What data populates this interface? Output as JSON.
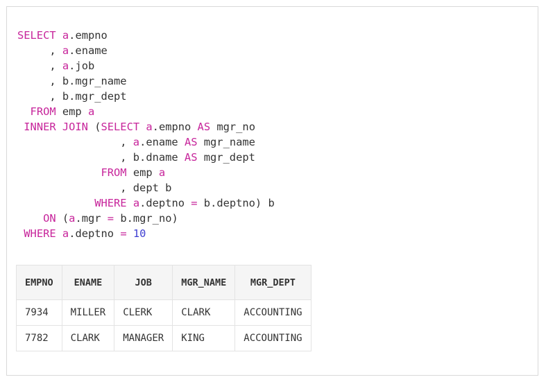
{
  "sql": {
    "lines": [
      [
        {
          "t": "SELECT",
          "c": "k"
        },
        {
          "t": " "
        },
        {
          "t": "a",
          "c": "k"
        },
        {
          "t": ".empno"
        }
      ],
      [
        {
          "t": "     , "
        },
        {
          "t": "a",
          "c": "k"
        },
        {
          "t": ".ename"
        }
      ],
      [
        {
          "t": "     , "
        },
        {
          "t": "a",
          "c": "k"
        },
        {
          "t": ".job"
        }
      ],
      [
        {
          "t": "     , b.mgr_name"
        }
      ],
      [
        {
          "t": "     , b.mgr_dept"
        }
      ],
      [
        {
          "t": "  "
        },
        {
          "t": "FROM",
          "c": "k"
        },
        {
          "t": " emp "
        },
        {
          "t": "a",
          "c": "k"
        }
      ],
      [
        {
          "t": " "
        },
        {
          "t": "INNER JOIN",
          "c": "k"
        },
        {
          "t": " ("
        },
        {
          "t": "SELECT",
          "c": "k"
        },
        {
          "t": " "
        },
        {
          "t": "a",
          "c": "k"
        },
        {
          "t": ".empno "
        },
        {
          "t": "AS",
          "c": "k"
        },
        {
          "t": " mgr_no"
        }
      ],
      [
        {
          "t": "                , "
        },
        {
          "t": "a",
          "c": "k"
        },
        {
          "t": ".ename "
        },
        {
          "t": "AS",
          "c": "k"
        },
        {
          "t": " mgr_name"
        }
      ],
      [
        {
          "t": "                , b.dname "
        },
        {
          "t": "AS",
          "c": "k"
        },
        {
          "t": " mgr_dept"
        }
      ],
      [
        {
          "t": "             "
        },
        {
          "t": "FROM",
          "c": "k"
        },
        {
          "t": " emp "
        },
        {
          "t": "a",
          "c": "k"
        }
      ],
      [
        {
          "t": "                , dept b"
        }
      ],
      [
        {
          "t": "            "
        },
        {
          "t": "WHERE",
          "c": "k"
        },
        {
          "t": " "
        },
        {
          "t": "a",
          "c": "k"
        },
        {
          "t": ".deptno "
        },
        {
          "t": "=",
          "c": "k"
        },
        {
          "t": " b.deptno) b"
        }
      ],
      [
        {
          "t": "    "
        },
        {
          "t": "ON",
          "c": "k"
        },
        {
          "t": " ("
        },
        {
          "t": "a",
          "c": "k"
        },
        {
          "t": ".mgr "
        },
        {
          "t": "=",
          "c": "k"
        },
        {
          "t": " b.mgr_no)"
        }
      ],
      [
        {
          "t": " "
        },
        {
          "t": "WHERE",
          "c": "k"
        },
        {
          "t": " "
        },
        {
          "t": "a",
          "c": "k"
        },
        {
          "t": ".deptno "
        },
        {
          "t": "=",
          "c": "k"
        },
        {
          "t": " "
        },
        {
          "t": "10",
          "c": "n"
        }
      ]
    ]
  },
  "result_table": {
    "headers": [
      "EMPNO",
      "ENAME",
      "JOB",
      "MGR_NAME",
      "MGR_DEPT"
    ],
    "rows": [
      [
        "7934",
        "MILLER",
        "CLERK",
        "CLARK",
        "ACCOUNTING"
      ],
      [
        "7782",
        "CLARK",
        "MANAGER",
        "KING",
        "ACCOUNTING"
      ]
    ]
  },
  "colors": {
    "keyword": "#c7259b",
    "number": "#3f3fd2",
    "text": "#333333"
  }
}
